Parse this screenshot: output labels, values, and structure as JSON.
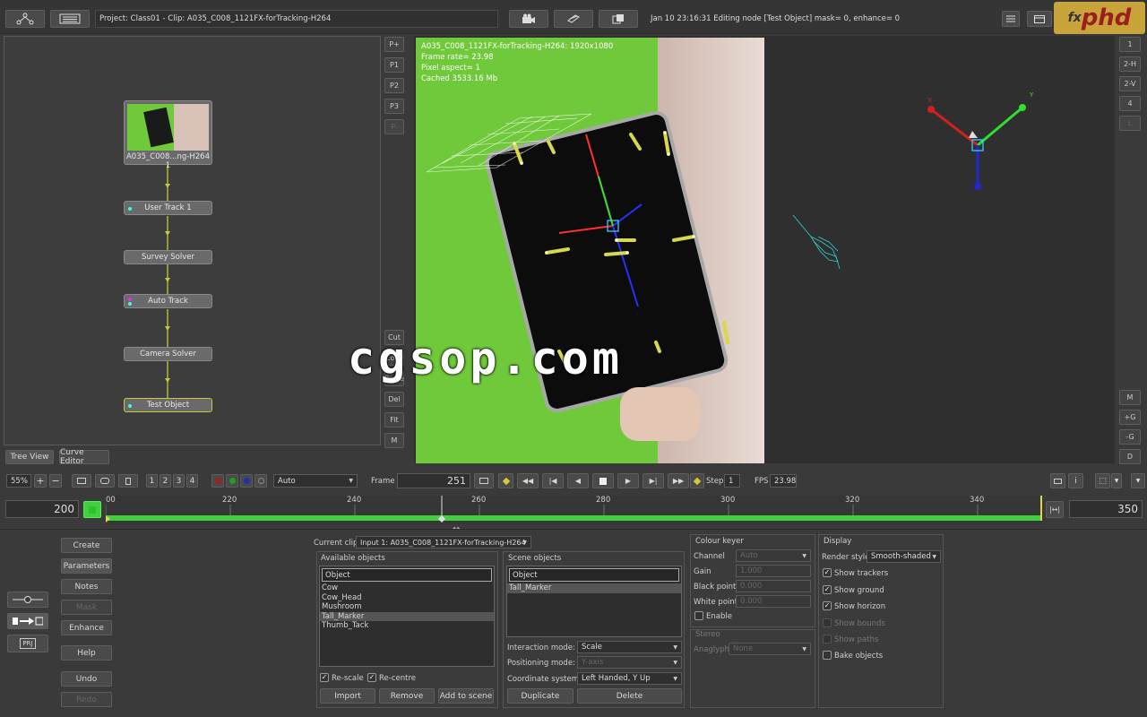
{
  "topbar": {
    "project": "Project: Class01 - Clip: A035_C008_1121FX-forTracking-H264",
    "status": "Jan 10 23:16:31 Editing node [Test Object] mask= 0, enhance= 0",
    "logo": "phd",
    "logo_prefix": "fx"
  },
  "nodes": {
    "clip": "A035_C008...ng-H264 1",
    "items": [
      "User Track 1",
      "Survey Solver",
      "Auto Track",
      "Camera Solver",
      "Test Object"
    ]
  },
  "preset_buttons": [
    "P+",
    "P1",
    "P2",
    "P3",
    "P-"
  ],
  "node_side_buttons": [
    "Cut",
    "Copy",
    "Paste",
    "Del",
    "Fit",
    "M"
  ],
  "tabs": {
    "tree_view": "Tree View",
    "curve_editor": "Curve Editor"
  },
  "viewer": {
    "clip_info": "A035_C008_1121FX-forTracking-H264: 1920x1080",
    "frame_rate": "Frame rate= 23.98",
    "pixel_aspect": "Pixel aspect= 1",
    "cached": "Cached 3533.16 Mb"
  },
  "watermark": "cgsop.com",
  "right_buttons_top": [
    "1",
    "2-H",
    "2-V",
    "4",
    "L"
  ],
  "right_buttons_bottom": [
    "M",
    "+G",
    "-G",
    "D"
  ],
  "transport": {
    "zoom": "55%",
    "view_numbers": [
      "1",
      "2",
      "3",
      "4"
    ],
    "mode": "Auto",
    "frame_label": "Frame",
    "frame": "251",
    "step_label": "Step",
    "step": "1",
    "fps_label": "FPS",
    "fps": "23.98"
  },
  "timeline": {
    "start": "200",
    "end": "350",
    "ticks": [
      "00",
      "220",
      "240",
      "260",
      "280",
      "300",
      "320",
      "340"
    ]
  },
  "left_buttons": {
    "create": "Create",
    "parameters": "Parameters",
    "notes": "Notes",
    "mask": "Mask",
    "enhance": "Enhance",
    "help": "Help",
    "undo": "Undo",
    "redo": "Redo",
    "proj_icon_text": "PRJ"
  },
  "params": {
    "current_clip_label": "Current clip",
    "current_clip": "Input 1: A035_C008_1121FX-forTracking-H264",
    "available_objects_title": "Available objects",
    "available_header": "Object",
    "available_items": [
      "Cow",
      "Cow_Head",
      "Mushroom",
      "Tall_Marker",
      "Thumb_Tack"
    ],
    "available_selected": 3,
    "rescale": "Re-scale",
    "recentre": "Re-centre",
    "import": "Import",
    "remove": "Remove",
    "add_to_scene": "Add to scene",
    "scene_objects_title": "Scene objects",
    "scene_header": "Object",
    "scene_items": [
      "Tall_Marker"
    ],
    "interaction_mode_label": "Interaction mode:",
    "interaction_mode": "Scale",
    "positioning_mode_label": "Positioning mode:",
    "positioning_mode": "Y-axis",
    "coordinate_system_label": "Coordinate system:",
    "coordinate_system": "Left Handed, Y Up",
    "duplicate": "Duplicate",
    "delete": "Delete"
  },
  "colour_keyer": {
    "title": "Colour keyer",
    "channel_label": "Channel",
    "channel": "Auto",
    "gain_label": "Gain",
    "gain": "1.000",
    "black_label": "Black point",
    "black": "0.000",
    "white_label": "White point",
    "white": "0.000",
    "enable": "Enable",
    "stereo_title": "Stereo",
    "anaglyph_label": "Anaglyph",
    "anaglyph": "None"
  },
  "display": {
    "title": "Display",
    "render_style_label": "Render style",
    "render_style": "Smooth-shaded",
    "show_trackers": "Show trackers",
    "show_ground": "Show ground",
    "show_horizon": "Show horizon",
    "show_bounds": "Show bounds",
    "show_paths": "Show paths",
    "bake_objects": "Bake objects"
  },
  "colors": {
    "green_screen": "#6fc93a",
    "timeline_green": "#3fcf3f",
    "accent_yellow": "#c8c83a"
  }
}
